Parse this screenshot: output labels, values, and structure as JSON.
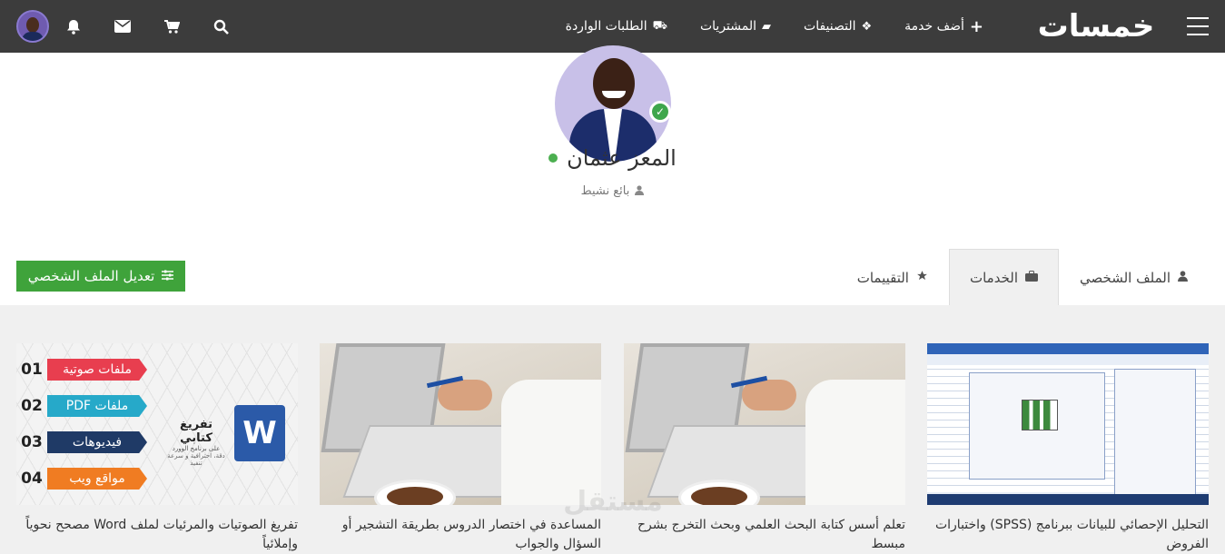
{
  "header": {
    "logo_text": "خمسات",
    "nav": [
      {
        "label": "أضف خدمة",
        "icon": "plus-icon"
      },
      {
        "label": "التصنيفات",
        "icon": "cubes-icon"
      },
      {
        "label": "المشتريات",
        "icon": "folder-icon"
      },
      {
        "label": "الطلبات الواردة",
        "icon": "truck-icon"
      }
    ],
    "icons": [
      "search-icon",
      "cart-icon",
      "envelope-icon",
      "bell-icon",
      "user-avatar"
    ]
  },
  "profile": {
    "name": "المعز عثمان",
    "role": "بائع نشيط",
    "online_color": "#4caf50",
    "verified_color": "#3ea64c"
  },
  "tabs": [
    {
      "label": "الملف الشخصي",
      "icon": "user-icon",
      "active": false
    },
    {
      "label": "الخدمات",
      "icon": "briefcase-icon",
      "active": true
    },
    {
      "label": "التقييمات",
      "icon": "star-icon",
      "active": false
    }
  ],
  "edit_button": {
    "label": "تعديل الملف الشخصي",
    "icon": "sliders-icon",
    "color": "#3fa33b"
  },
  "services": [
    {
      "title": "التحليل الإحصائي للبيانات ببرنامج (SPSS) واختبارات الفروض"
    },
    {
      "title": "تعلم أسس كتابة البحث العلمي وبحث التخرج بشرح مبسط"
    },
    {
      "title": "المساعدة في اختصار الدروس بطريقة التشجير أو السؤال والجواب"
    },
    {
      "title": "تفريغ الصوتيات والمرئيات لملف Word مصحح نحوياً وإملائياً"
    }
  ],
  "transcription_thumb": {
    "rows": [
      {
        "num": "01",
        "label": "ملفات صوتية",
        "color": "#e83e4f"
      },
      {
        "num": "02",
        "label": "ملفات PDF",
        "color": "#26a9c9"
      },
      {
        "num": "03",
        "label": "فيديوهات",
        "color": "#1f3a66"
      },
      {
        "num": "04",
        "label": "مواقع ويب",
        "color": "#f07c22"
      }
    ],
    "word_letter": "W",
    "title": "تفريغ كتابي",
    "subtitle": "على برنامج الوورد",
    "tagline": "دقة، احترافية و سرعة تنفيذ"
  },
  "watermark": "مستقل"
}
